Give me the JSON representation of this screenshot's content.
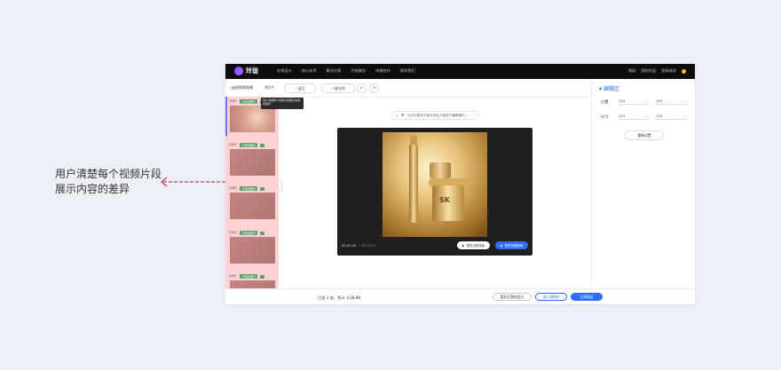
{
  "annotation": {
    "text": "用户清楚每个视频片段展示内容的差异"
  },
  "topbar": {
    "logo_text": "玲珑",
    "nav": [
      "在线设计",
      "核心技术",
      "解决方案",
      "开放服务",
      "终端合作",
      "联系我们"
    ],
    "right": [
      "帮助",
      "我的作品",
      "登录体验"
    ]
  },
  "toolbar": {
    "title": "当前视频场景",
    "count": "共5个",
    "back": "返回",
    "replace": "一键去除",
    "undo_icon": "undo-icon",
    "redo_icon": "redo-icon"
  },
  "tooltip": {
    "text": "用户清楚每个视频片段展示内容的差异"
  },
  "clips": [
    {
      "index": "场景1",
      "tag": "已锁定图片"
    },
    {
      "index": "场景2",
      "tag": "已锁定图片"
    },
    {
      "index": "场景3",
      "tag": "已锁定图片"
    },
    {
      "index": "场景4",
      "tag": "已锁定图片"
    },
    {
      "index": "场景5",
      "tag": "已锁定图片"
    }
  ],
  "stage": {
    "hint": "再一次点击换页方案可对此方案进行编辑操作...",
    "time_current": "00:02:00",
    "time_total": "00:15:00",
    "btn_preview": "预览当前场景",
    "btn_preview_all": "预览完整视频"
  },
  "panel": {
    "title": "编辑区",
    "fields": [
      {
        "label": "位置",
        "a": "123",
        "b": "123"
      },
      {
        "label": "尺寸",
        "a": "123",
        "b": "123"
      }
    ],
    "button": "重新设置"
  },
  "footer": {
    "summary": "已选 1 张，合计 ￥18.88",
    "save_draft": "暂存至我的设计",
    "add_cart": "加入购物车",
    "buy_now": "立即购买"
  },
  "colors": {
    "accent": "#2f6ef5",
    "clip_bg": "#ffd3d6",
    "tag_green": "#5a9f63"
  }
}
